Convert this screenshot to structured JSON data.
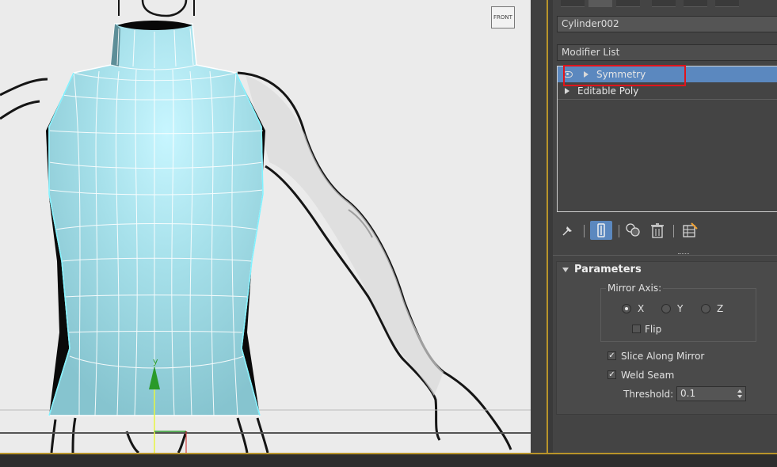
{
  "viewport": {
    "name": "Front viewport",
    "view_cube_label": "FRONT",
    "gizmo_axis_label": "y"
  },
  "panel": {
    "object_name": "Cylinder002",
    "modifier_list_label": "Modifier List",
    "stack": [
      {
        "label": "Symmetry",
        "selected": true,
        "has_eye": true
      },
      {
        "label": "Editable Poly",
        "selected": false,
        "has_eye": false
      }
    ],
    "toolbar_icons": [
      "pin-stack-icon",
      "show-end-result-icon",
      "make-unique-icon",
      "remove-modifier-icon",
      "configure-modifier-sets-icon"
    ],
    "rollout": {
      "title": "Parameters",
      "mirror_axis_label": "Mirror Axis:",
      "axes": [
        {
          "label": "X",
          "checked": true
        },
        {
          "label": "Y",
          "checked": false
        },
        {
          "label": "Z",
          "checked": false
        }
      ],
      "flip_label": "Flip",
      "flip_checked": false,
      "slice_label": "Slice Along Mirror",
      "slice_checked": true,
      "weld_label": "Weld Seam",
      "weld_checked": true,
      "threshold_label": "Threshold:",
      "threshold_value": "0.1"
    }
  },
  "colors": {
    "selection": "#5b88bf",
    "highlight_box": "#e0141b",
    "mesh": "#9fdbe6",
    "viewport_border": "#b8942a"
  }
}
